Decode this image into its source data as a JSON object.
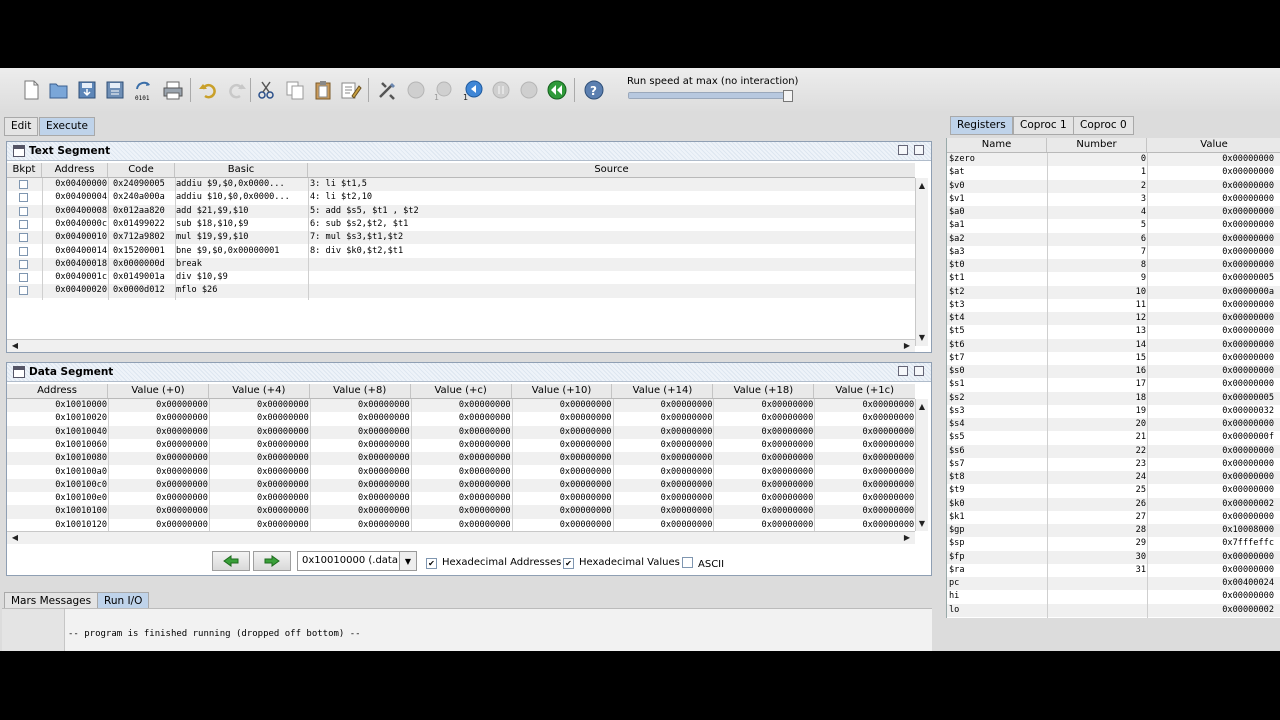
{
  "toolbar": {
    "run_speed_label": "Run speed at max (no interaction)",
    "run_speed_fraction": 1.0,
    "icons": [
      "new-file-icon",
      "open-file-icon",
      "save-icon",
      "save-as-icon",
      "dump-memory-icon",
      "print-icon",
      "undo-icon",
      "redo-icon",
      "cut-icon",
      "copy-icon",
      "paste-icon",
      "find-replace-icon",
      "assemble-icon",
      "run-icon",
      "step-icon",
      "backstep-icon",
      "pause-icon",
      "stop-icon",
      "reset-icon",
      "help-icon"
    ]
  },
  "tabs": {
    "edit": "Edit",
    "execute": "Execute"
  },
  "text_segment": {
    "title": "Text Segment",
    "columns": [
      "Bkpt",
      "Address",
      "Code",
      "Basic",
      "Source"
    ],
    "rows": [
      {
        "address": "0x00400000",
        "code": "0x24090005",
        "basic": "addiu $9,$0,0x0000...",
        "source": "3: li $t1,5"
      },
      {
        "address": "0x00400004",
        "code": "0x240a000a",
        "basic": "addiu $10,$0,0x0000...",
        "source": "4: li $t2,10"
      },
      {
        "address": "0x00400008",
        "code": "0x012aa820",
        "basic": "add $21,$9,$10",
        "source": "5: add $s5, $t1 , $t2"
      },
      {
        "address": "0x0040000c",
        "code": "0x01499022",
        "basic": "sub $18,$10,$9",
        "source": "6: sub $s2,$t2, $t1"
      },
      {
        "address": "0x00400010",
        "code": "0x712a9802",
        "basic": "mul $19,$9,$10",
        "source": "7: mul $s3,$t1,$t2"
      },
      {
        "address": "0x00400014",
        "code": "0x15200001",
        "basic": "bne $9,$0,0x00000001",
        "source": "8: div $k0,$t2,$t1"
      },
      {
        "address": "0x00400018",
        "code": "0x0000000d",
        "basic": "break",
        "source": ""
      },
      {
        "address": "0x0040001c",
        "code": "0x0149001a",
        "basic": "div $10,$9",
        "source": ""
      },
      {
        "address": "0x00400020",
        "code": "0x0000d012",
        "basic": "mflo $26",
        "source": ""
      }
    ]
  },
  "data_segment": {
    "title": "Data Segment",
    "columns": [
      "Address",
      "Value (+0)",
      "Value (+4)",
      "Value (+8)",
      "Value (+c)",
      "Value (+10)",
      "Value (+14)",
      "Value (+18)",
      "Value (+1c)"
    ],
    "addresses": [
      "0x10010000",
      "0x10010020",
      "0x10010040",
      "0x10010060",
      "0x10010080",
      "0x100100a0",
      "0x100100c0",
      "0x100100e0",
      "0x10010100",
      "0x10010120"
    ],
    "cell_value": "0x00000000",
    "segment_select": "0x10010000 (.data)",
    "hex_addresses_label": "Hexadecimal Addresses",
    "hex_values_label": "Hexadecimal Values",
    "ascii_label": "ASCII",
    "hex_addresses_checked": true,
    "hex_values_checked": true,
    "ascii_checked": false
  },
  "messages": {
    "tab_mars": "Mars Messages",
    "tab_runio": "Run I/O",
    "text": "-- program is finished running (dropped off bottom) --"
  },
  "registers": {
    "tabs": [
      "Registers",
      "Coproc 1",
      "Coproc 0"
    ],
    "columns": [
      "Name",
      "Number",
      "Value"
    ],
    "rows": [
      [
        "$zero",
        "0",
        "0x00000000"
      ],
      [
        "$at",
        "1",
        "0x00000000"
      ],
      [
        "$v0",
        "2",
        "0x00000000"
      ],
      [
        "$v1",
        "3",
        "0x00000000"
      ],
      [
        "$a0",
        "4",
        "0x00000000"
      ],
      [
        "$a1",
        "5",
        "0x00000000"
      ],
      [
        "$a2",
        "6",
        "0x00000000"
      ],
      [
        "$a3",
        "7",
        "0x00000000"
      ],
      [
        "$t0",
        "8",
        "0x00000000"
      ],
      [
        "$t1",
        "9",
        "0x00000005"
      ],
      [
        "$t2",
        "10",
        "0x0000000a"
      ],
      [
        "$t3",
        "11",
        "0x00000000"
      ],
      [
        "$t4",
        "12",
        "0x00000000"
      ],
      [
        "$t5",
        "13",
        "0x00000000"
      ],
      [
        "$t6",
        "14",
        "0x00000000"
      ],
      [
        "$t7",
        "15",
        "0x00000000"
      ],
      [
        "$s0",
        "16",
        "0x00000000"
      ],
      [
        "$s1",
        "17",
        "0x00000000"
      ],
      [
        "$s2",
        "18",
        "0x00000005"
      ],
      [
        "$s3",
        "19",
        "0x00000032"
      ],
      [
        "$s4",
        "20",
        "0x00000000"
      ],
      [
        "$s5",
        "21",
        "0x0000000f"
      ],
      [
        "$s6",
        "22",
        "0x00000000"
      ],
      [
        "$s7",
        "23",
        "0x00000000"
      ],
      [
        "$t8",
        "24",
        "0x00000000"
      ],
      [
        "$t9",
        "25",
        "0x00000000"
      ],
      [
        "$k0",
        "26",
        "0x00000002"
      ],
      [
        "$k1",
        "27",
        "0x00000000"
      ],
      [
        "$gp",
        "28",
        "0x10008000"
      ],
      [
        "$sp",
        "29",
        "0x7fffeffc"
      ],
      [
        "$fp",
        "30",
        "0x00000000"
      ],
      [
        "$ra",
        "31",
        "0x00000000"
      ],
      [
        "pc",
        "",
        "0x00400024"
      ],
      [
        "hi",
        "",
        "0x00000000"
      ],
      [
        "lo",
        "",
        "0x00000002"
      ]
    ]
  }
}
